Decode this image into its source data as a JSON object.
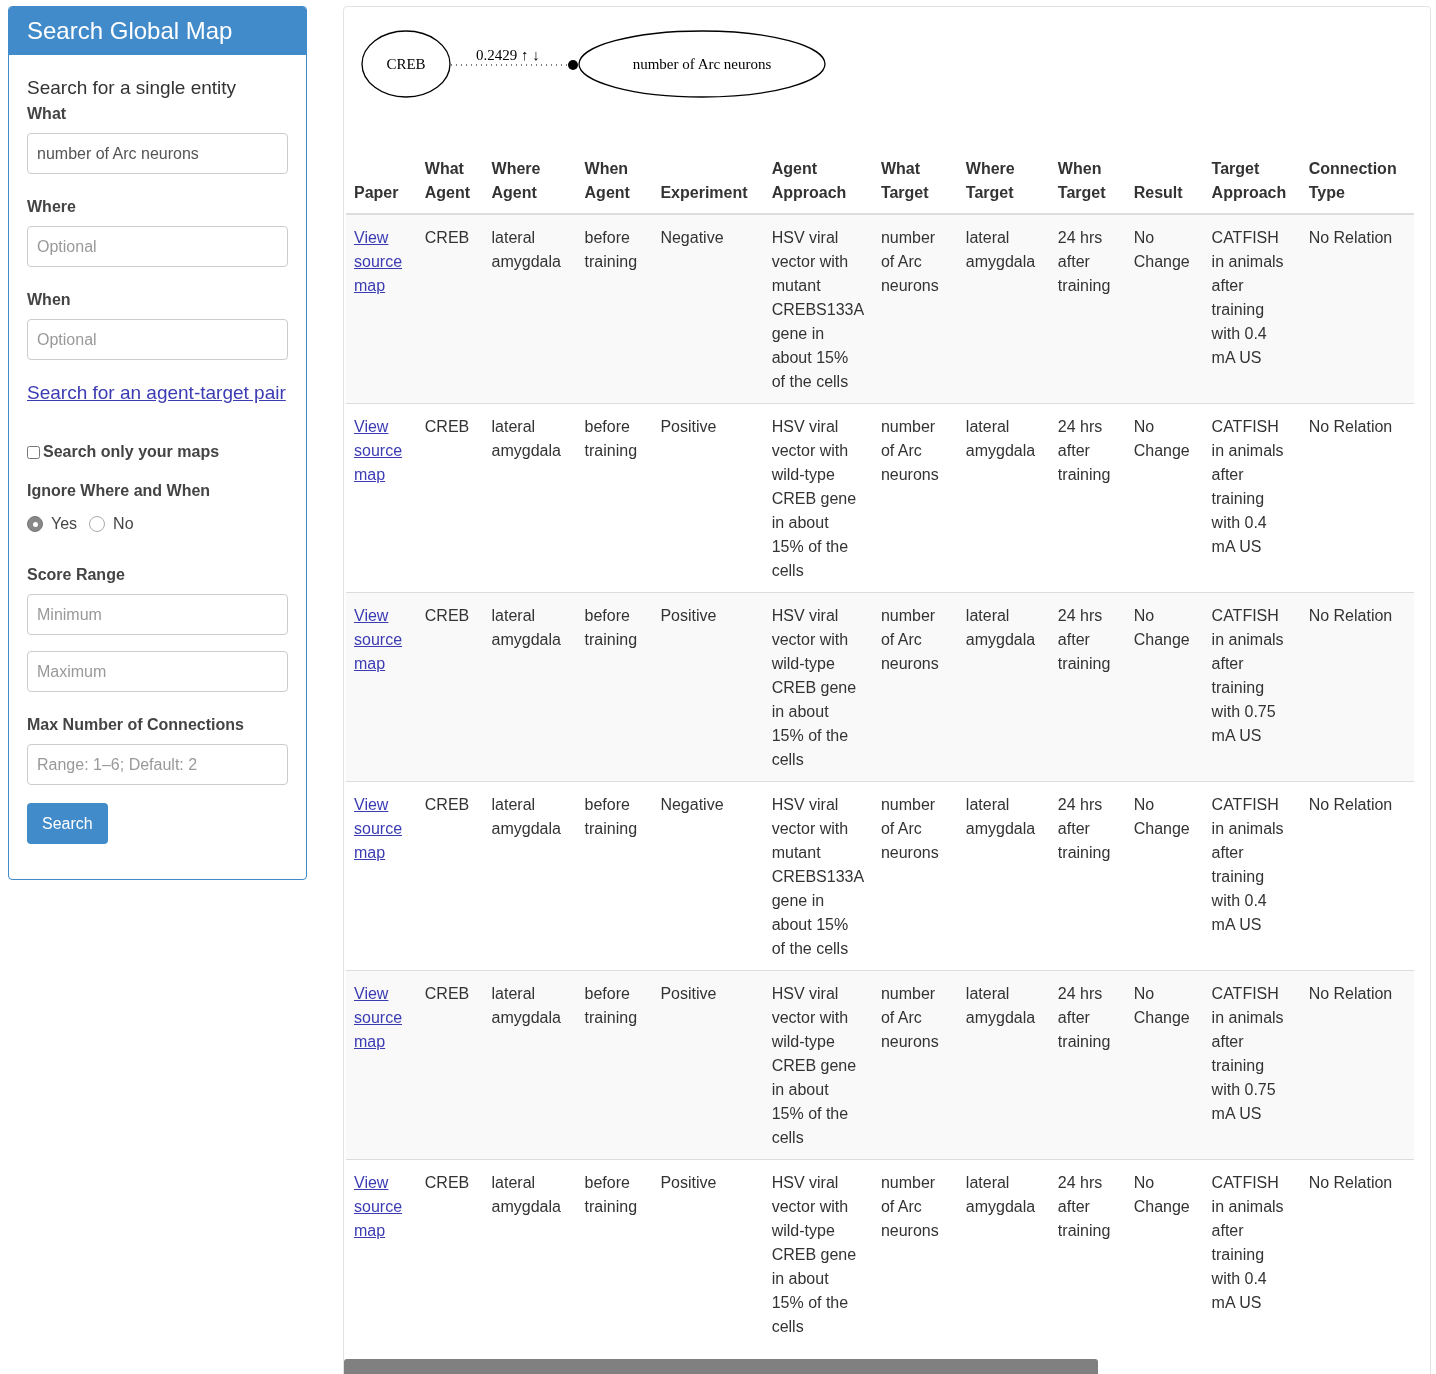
{
  "sidebar": {
    "title": "Search Global Map",
    "subtitle": "Search for a single entity",
    "fields": [
      {
        "label": "What",
        "value": "number of Arc neurons"
      },
      {
        "label": "Where",
        "placeholder": "Optional"
      },
      {
        "label": "When",
        "placeholder": "Optional"
      }
    ],
    "pair_link": "Search for an agent-target pair",
    "only_mine": {
      "label": "Search only your maps",
      "checked": false
    },
    "ignore": {
      "label": "Ignore Where and When",
      "options": [
        {
          "label": "Yes",
          "selected": true
        },
        {
          "label": "No",
          "selected": false
        }
      ]
    },
    "score": {
      "label": "Score Range",
      "fields": [
        {
          "placeholder": "Minimum"
        },
        {
          "placeholder": "Maximum"
        }
      ]
    },
    "max_conn": {
      "label": "Max Number of Connections",
      "placeholder": "Range: 1–6; Default: 2"
    },
    "button": "Search"
  },
  "graph": {
    "source": "CREB",
    "target": "number of Arc neurons",
    "edge_label": "0.2429 ↑ ↓"
  },
  "table": {
    "columns": [
      "Paper",
      "What Agent",
      "Where Agent",
      "When Agent",
      "Experiment",
      "Agent Approach",
      "What Target",
      "Where Target",
      "When Target",
      "Result",
      "Target Approach",
      "Connection Type"
    ],
    "rows": [
      [
        "View source map",
        "CREB",
        "lateral amygdala",
        "before training",
        "Negative",
        "HSV viral vector with mutant CREBS133A gene in about 15% of the cells",
        "number of Arc neurons",
        "lateral amygdala",
        "24 hrs after training",
        "No Change",
        "CATFISH in animals after training with 0.4 mA US",
        "No Relation"
      ],
      [
        "View source map",
        "CREB",
        "lateral amygdala",
        "before training",
        "Positive",
        "HSV viral vector with wild-type CREB gene in about 15% of the cells",
        "number of Arc neurons",
        "lateral amygdala",
        "24 hrs after training",
        "No Change",
        "CATFISH in animals after training with 0.4 mA US",
        "No Relation"
      ],
      [
        "View source map",
        "CREB",
        "lateral amygdala",
        "before training",
        "Positive",
        "HSV viral vector with wild-type CREB gene in about 15% of the cells",
        "number of Arc neurons",
        "lateral amygdala",
        "24 hrs after training",
        "No Change",
        "CATFISH in animals after training with 0.75 mA US",
        "No Relation"
      ],
      [
        "View source map",
        "CREB",
        "lateral amygdala",
        "before training",
        "Negative",
        "HSV viral vector with mutant CREBS133A gene in about 15% of the cells",
        "number of Arc neurons",
        "lateral amygdala",
        "24 hrs after training",
        "No Change",
        "CATFISH in animals after training with 0.4 mA US",
        "No Relation"
      ],
      [
        "View source map",
        "CREB",
        "lateral amygdala",
        "before training",
        "Positive",
        "HSV viral vector with wild-type CREB gene in about 15% of the cells",
        "number of Arc neurons",
        "lateral amygdala",
        "24 hrs after training",
        "No Change",
        "CATFISH in animals after training with 0.75 mA US",
        "No Relation"
      ],
      [
        "View source map",
        "CREB",
        "lateral amygdala",
        "before training",
        "Positive",
        "HSV viral vector with wild-type CREB gene in about 15% of the cells",
        "number of Arc neurons",
        "lateral amygdala",
        "24 hrs after training",
        "No Change",
        "CATFISH in animals after training with 0.4 mA US",
        "No Relation"
      ]
    ]
  }
}
